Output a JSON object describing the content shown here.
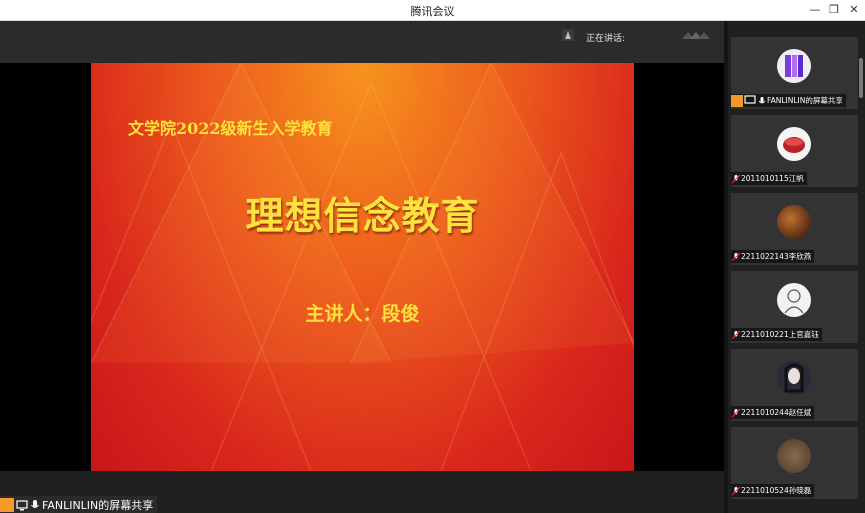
{
  "window": {
    "title": "腾讯会议"
  },
  "topbar": {
    "speaking_label": "正在讲话:"
  },
  "slide": {
    "subtitle": "文学院2022级新生入学教育",
    "title": "理想信念教育",
    "speaker": "主讲人：段俊"
  },
  "share": {
    "label": "FANLINLIN的屏幕共享"
  },
  "participants": [
    {
      "name": "FANLINLIN的屏幕共享",
      "avatar": "purple-logo"
    },
    {
      "name": "2011010115江帆",
      "avatar": "red-cake"
    },
    {
      "name": "2211022143李欣燕",
      "avatar": "dark-orb"
    },
    {
      "name": "2211010221上官嘉钰",
      "avatar": "sketch-figure"
    },
    {
      "name": "2211010244赵任斌",
      "avatar": "dark-portrait"
    },
    {
      "name": "2211010524孙晓磊",
      "avatar": "brown-photo"
    }
  ],
  "colors": {
    "accent": "#f39a2b",
    "slide_text": "#ffe23b"
  }
}
